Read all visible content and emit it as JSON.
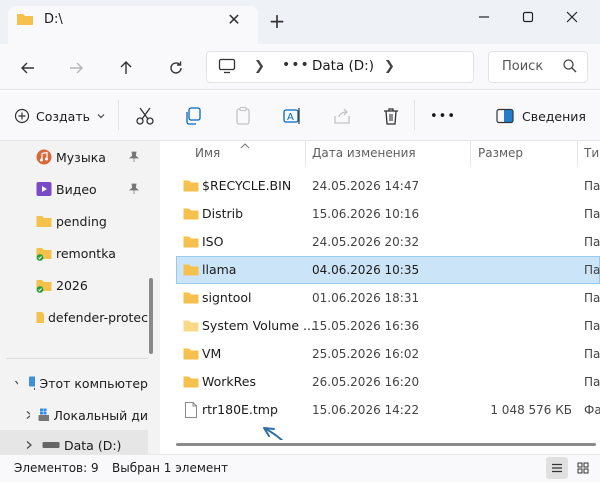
{
  "window": {
    "tab_title": "D:\\",
    "new_tab_symbol": "+"
  },
  "address": {
    "more": "•••",
    "drive": "Data (D:)"
  },
  "search": {
    "placeholder": "Поиск"
  },
  "toolbar": {
    "create_label": "Создать",
    "details_label": "Сведения",
    "more_symbol": "•••"
  },
  "sidebar": {
    "items": [
      {
        "label": "Музыка"
      },
      {
        "label": "Видео"
      },
      {
        "label": "pending"
      },
      {
        "label": "remontka"
      },
      {
        "label": "2026"
      },
      {
        "label": "defender-protec"
      },
      {
        "label": "Этот компьютер"
      },
      {
        "label": "Локальный ди"
      },
      {
        "label": "Data (D:)"
      }
    ]
  },
  "columns": {
    "name": "Имя",
    "date": "Дата изменения",
    "size": "Размер",
    "type": "Ти"
  },
  "files": [
    {
      "name": "$RECYCLE.BIN",
      "date": "24.05.2026 14:47",
      "type": "Па",
      "size": ""
    },
    {
      "name": "Distrib",
      "date": "15.06.2026 10:16",
      "type": "Па",
      "size": ""
    },
    {
      "name": "ISO",
      "date": "24.05.2026 20:32",
      "type": "Па",
      "size": ""
    },
    {
      "name": "llama",
      "date": "04.06.2026 10:35",
      "type": "Па",
      "size": ""
    },
    {
      "name": "signtool",
      "date": "01.06.2026 18:31",
      "type": "Па",
      "size": ""
    },
    {
      "name": "System Volume ...",
      "date": "15.05.2026 16:36",
      "type": "Па",
      "size": ""
    },
    {
      "name": "VM",
      "date": "25.05.2026 16:02",
      "type": "Па",
      "size": ""
    },
    {
      "name": "WorkRes",
      "date": "26.05.2026 16:20",
      "type": "Па",
      "size": ""
    },
    {
      "name": "rtr180E.tmp",
      "date": "15.06.2026 14:22",
      "type": "Фа",
      "size": "1 048 576 КБ"
    }
  ],
  "status": {
    "count": "Элементов: 9",
    "selected": "Выбран 1 элемент"
  },
  "colors": {
    "folder": "#f4c14c",
    "selection": "#cce4f7",
    "accent": "#0067c0",
    "annotation_arrow": "#2f6da8"
  }
}
